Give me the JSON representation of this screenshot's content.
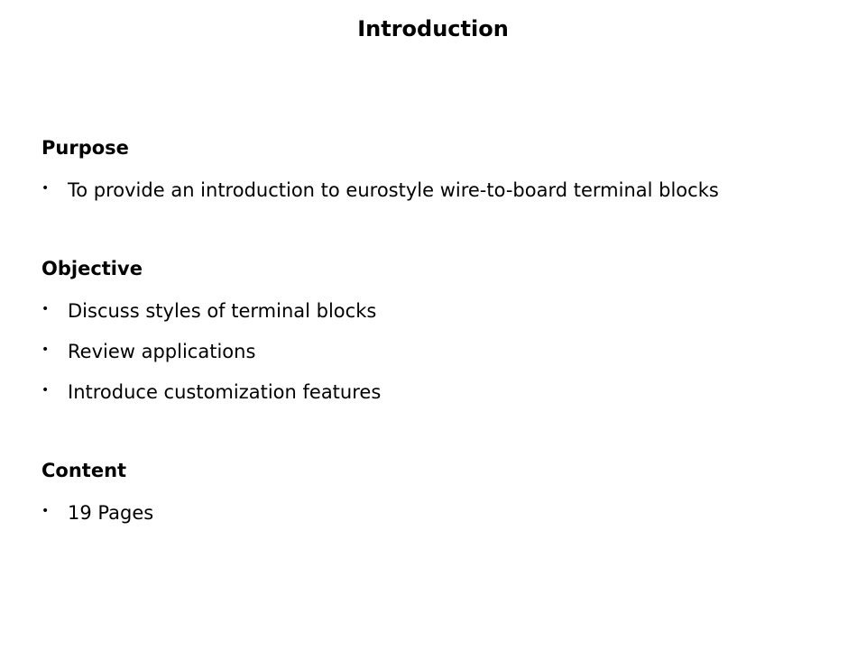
{
  "slide": {
    "title": "Introduction",
    "sections": [
      {
        "heading": "Purpose",
        "bullets": [
          "To provide an introduction to eurostyle wire-to-board terminal blocks"
        ]
      },
      {
        "heading": "Objective",
        "bullets": [
          "Discuss styles of terminal blocks",
          "Review applications",
          "Introduce customization features"
        ]
      },
      {
        "heading": "Content",
        "bullets": [
          "19 Pages"
        ]
      }
    ],
    "bullet_glyph": "•"
  }
}
